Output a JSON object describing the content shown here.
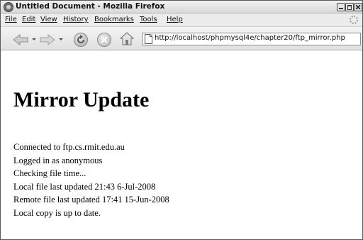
{
  "window": {
    "title": "Untitled Document - Mozilla Firefox"
  },
  "menu": {
    "items": [
      "File",
      "Edit",
      "View",
      "History",
      "Bookmarks",
      "Tools",
      "Help"
    ]
  },
  "toolbar": {
    "icons": [
      "back-icon",
      "forward-icon",
      "reload-icon",
      "stop-icon",
      "home-icon",
      "page-icon"
    ],
    "url": "http://localhost/phpmysql4e/chapter20/ftp_mirror.php"
  },
  "page": {
    "heading": "Mirror Update",
    "lines": [
      "Connected to ftp.cs.rmit.edu.au",
      "Logged in as anonymous",
      "Checking file time...",
      "Local file last updated 21:43 6-Jul-2008",
      "Remote file last updated 17:41 15-Jun-2008",
      "Local copy is up to date."
    ]
  }
}
